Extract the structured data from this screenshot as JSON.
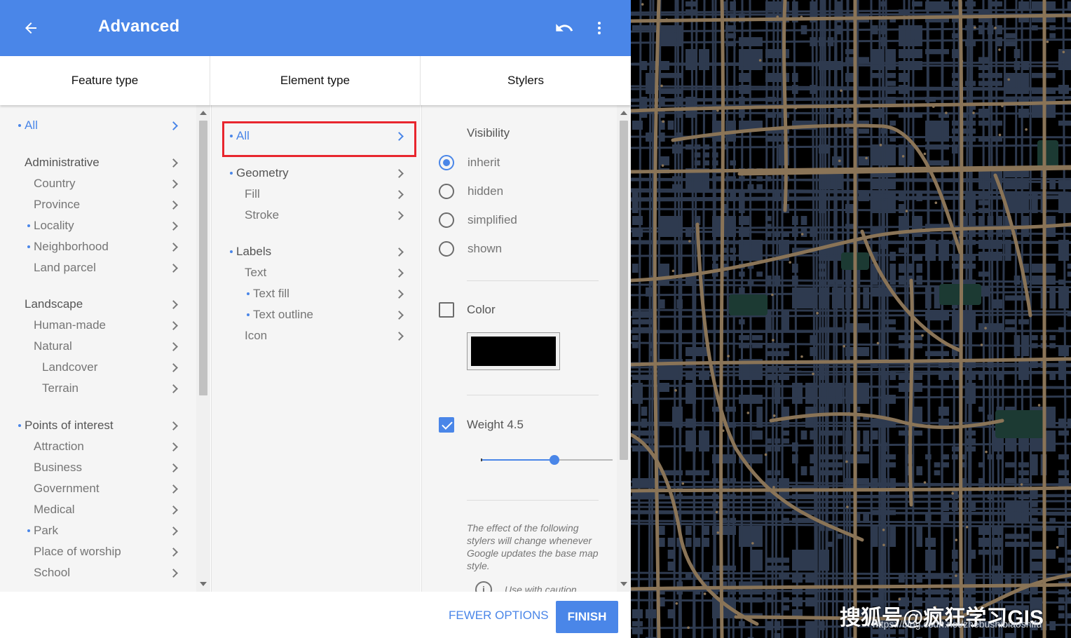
{
  "header": {
    "title": "Advanced",
    "back_icon": "arrow-back-icon",
    "undo_icon": "undo-icon",
    "more_icon": "more-vert-icon",
    "bg_color": "#4a86e8"
  },
  "columns": {
    "feature_type": "Feature type",
    "element_type": "Element type",
    "stylers": "Stylers"
  },
  "feature_types": [
    {
      "label": "All",
      "dot": true,
      "active": true
    },
    {
      "label": "Administrative",
      "dot": false
    },
    {
      "label": "Country",
      "dot": false
    },
    {
      "label": "Province",
      "dot": false
    },
    {
      "label": "Locality",
      "dot": true
    },
    {
      "label": "Neighborhood",
      "dot": true
    },
    {
      "label": "Land parcel",
      "dot": false
    },
    {
      "label": "Landscape",
      "dot": false
    },
    {
      "label": "Human-made",
      "dot": false
    },
    {
      "label": "Natural",
      "dot": false
    },
    {
      "label": "Landcover",
      "dot": false
    },
    {
      "label": "Terrain",
      "dot": false
    },
    {
      "label": "Points of interest",
      "dot": true
    },
    {
      "label": "Attraction",
      "dot": false
    },
    {
      "label": "Business",
      "dot": false
    },
    {
      "label": "Government",
      "dot": false
    },
    {
      "label": "Medical",
      "dot": false
    },
    {
      "label": "Park",
      "dot": true
    },
    {
      "label": "Place of worship",
      "dot": false
    },
    {
      "label": "School",
      "dot": false
    }
  ],
  "element_types": [
    {
      "label": "All",
      "dot": true,
      "active": true,
      "selected": true
    },
    {
      "label": "Geometry",
      "dot": true
    },
    {
      "label": "Fill",
      "dot": false
    },
    {
      "label": "Stroke",
      "dot": false
    },
    {
      "label": "Labels",
      "dot": true
    },
    {
      "label": "Text",
      "dot": false
    },
    {
      "label": "Text fill",
      "dot": true
    },
    {
      "label": "Text outline",
      "dot": true
    },
    {
      "label": "Icon",
      "dot": false
    }
  ],
  "stylers": {
    "visibility_heading": "Visibility",
    "visibility_options": [
      "inherit",
      "hidden",
      "simplified",
      "shown"
    ],
    "visibility_selected": "inherit",
    "color_label": "Color",
    "color_checked": false,
    "color_value": "#000000",
    "weight_label": "Weight 4.5",
    "weight_checked": true,
    "weight_slider_fraction": 0.56,
    "note": "The effect of the following stylers will change whenever Google updates the base map style.",
    "caution": "Use with caution."
  },
  "footer": {
    "fewer_options": "FEWER OPTIONS",
    "finish": "FINISH"
  },
  "map": {
    "background": "#000000",
    "block_color": "#2e3a4f",
    "road_color": "#8a7457",
    "park_color": "#1c3a33",
    "watermark": "搜狐号@疯狂学习GIS",
    "watermark_url": "https://blog.csdn.net/zhebushibiaoshifu"
  }
}
